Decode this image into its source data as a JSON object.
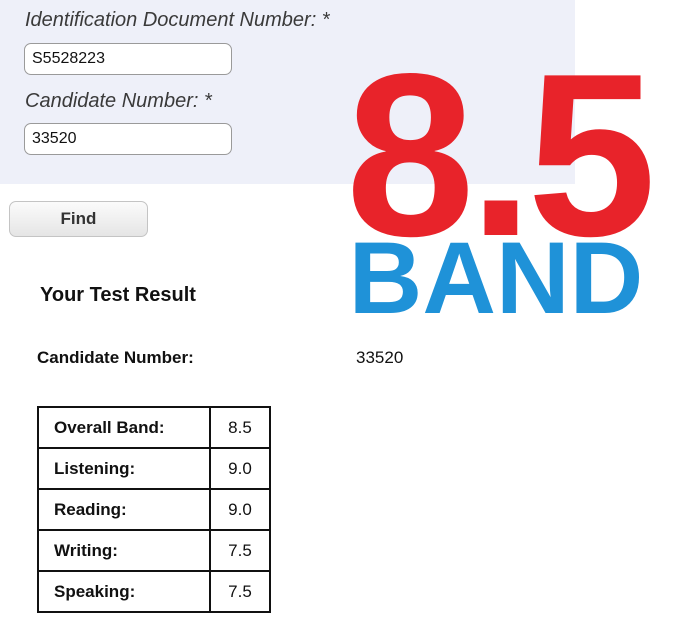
{
  "form": {
    "id_label": "Identification Document Number: *",
    "id_value": "S5528223",
    "candidate_label": "Candidate Number: *",
    "candidate_value": "33520",
    "find_label": "Find"
  },
  "result": {
    "title": "Your Test Result",
    "candidate_label": "Candidate Number:",
    "candidate_value": "33520",
    "scores": [
      {
        "label": "Overall Band:",
        "value": "8.5"
      },
      {
        "label": "Listening:",
        "value": "9.0"
      },
      {
        "label": "Reading:",
        "value": "9.0"
      },
      {
        "label": "Writing:",
        "value": "7.5"
      },
      {
        "label": "Speaking:",
        "value": "7.5"
      }
    ]
  },
  "overlay": {
    "score_text": "8.5",
    "band_text": "BAND",
    "score_color": "#e8232a",
    "band_color": "#1f92d8"
  }
}
